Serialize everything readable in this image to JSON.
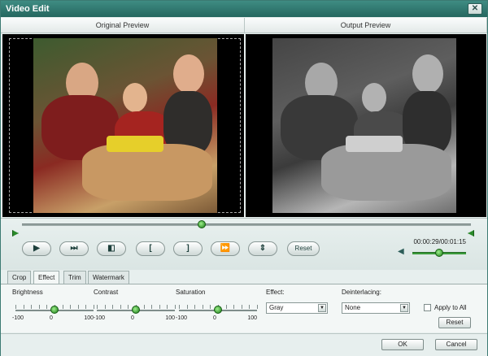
{
  "window": {
    "title": "Video Edit",
    "close_glyph": "✕"
  },
  "preview": {
    "original_label": "Original Preview",
    "output_label": "Output Preview",
    "output_effect_colors": {
      "original": "#8a2a22",
      "output": "#3b3b3b"
    }
  },
  "playback": {
    "time_text": "00:00:29/00:01:15",
    "seek_position": 0.4,
    "volume_level": 0.5,
    "buttons": [
      {
        "name": "play-button",
        "icon": "play-icon",
        "glyph": "▶"
      },
      {
        "name": "next-frame-button",
        "icon": "step-forward-icon",
        "glyph": "⏭"
      },
      {
        "name": "capture-button",
        "icon": "snapshot-icon",
        "glyph": "◧"
      },
      {
        "name": "set-start-button",
        "icon": "bracket-left-icon",
        "glyph": "["
      },
      {
        "name": "set-end-button",
        "icon": "bracket-right-icon",
        "glyph": "]"
      },
      {
        "name": "go-end-button",
        "icon": "go-end-icon",
        "glyph": "⏩"
      },
      {
        "name": "center-button",
        "icon": "center-icon",
        "glyph": "⇕"
      }
    ],
    "reset_label": "Reset"
  },
  "tabs": [
    {
      "label": "Crop",
      "active": false
    },
    {
      "label": "Effect",
      "active": true
    },
    {
      "label": "Trim",
      "active": false
    },
    {
      "label": "Watermark",
      "active": false
    }
  ],
  "effect": {
    "brightness": {
      "label": "Brightness",
      "min": "-100",
      "mid": "0",
      "max": "100",
      "value": 0
    },
    "contrast": {
      "label": "Contrast",
      "min": "-100",
      "mid": "0",
      "max": "100",
      "value": 0
    },
    "saturation": {
      "label": "Saturation",
      "min": "-100",
      "mid": "0",
      "max": "100",
      "value": 0
    },
    "effect_label": "Effect:",
    "effect_value": "Gray",
    "deinterlacing_label": "Deinterlacing:",
    "deinterlacing_value": "None",
    "apply_all_label": "Apply to All",
    "reset_label": "Reset"
  },
  "footer": {
    "ok_label": "OK",
    "cancel_label": "Cancel"
  }
}
